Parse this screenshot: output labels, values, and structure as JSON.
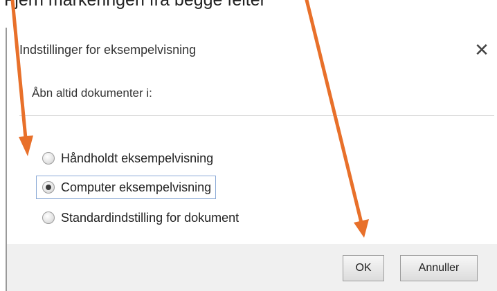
{
  "caption": {
    "text": "Fjern markeringen fra begge felter"
  },
  "dialog": {
    "title": "Indstillinger for eksempelvisning",
    "close_glyph": "✕",
    "group_label": "Åbn altid dokumenter i:",
    "options": [
      {
        "label": "Håndholdt eksempelvisning",
        "selected": false
      },
      {
        "label": "Computer eksempelvisning",
        "selected": true
      },
      {
        "label": "Standardindstilling for dokument",
        "selected": false
      }
    ],
    "buttons": {
      "ok": "OK",
      "cancel": "Annuller"
    }
  },
  "annotation": {
    "arrow_color": "#e8702a"
  }
}
